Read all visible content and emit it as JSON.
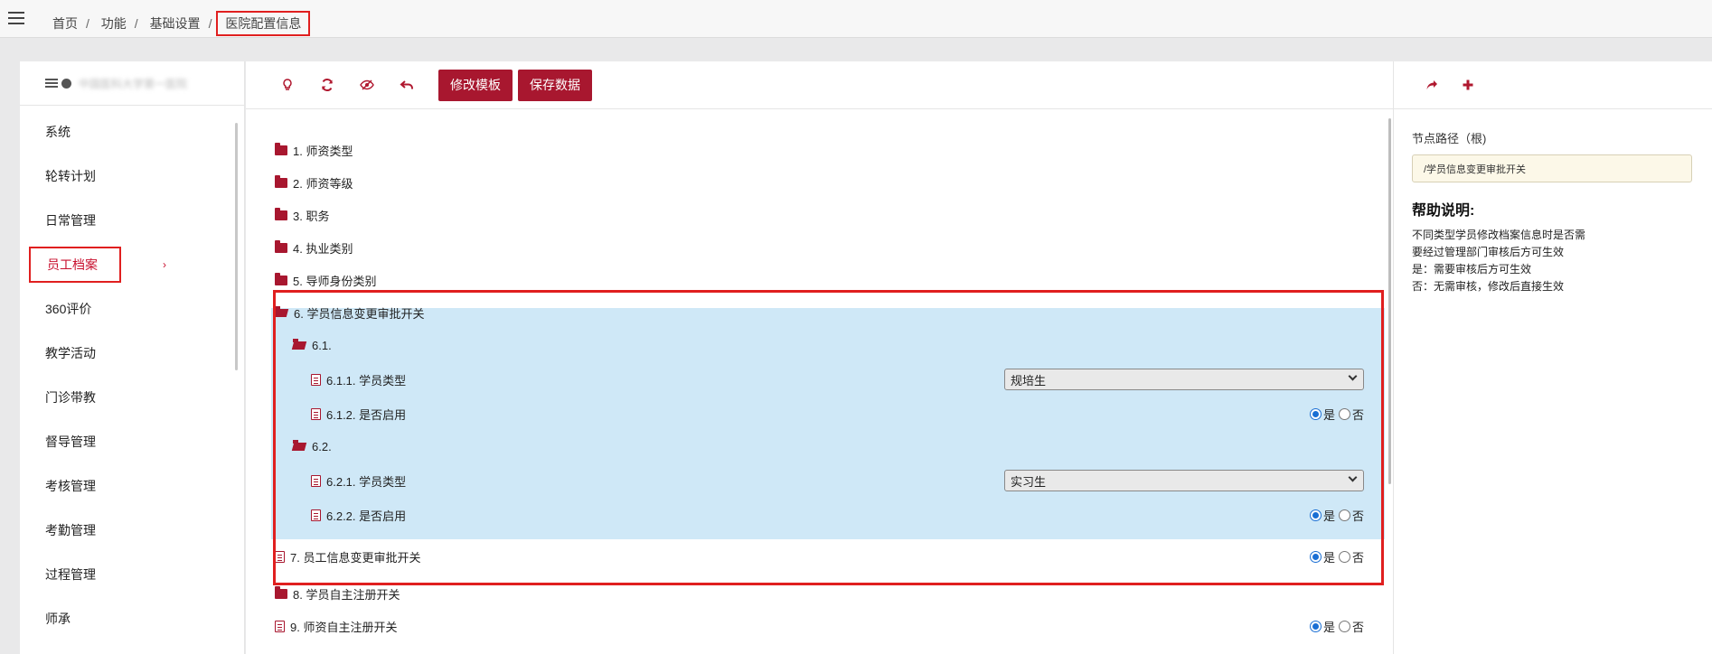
{
  "breadcrumb": {
    "items": [
      "首页",
      "功能",
      "基础设置"
    ],
    "current": "医院配置信息"
  },
  "sidebar": {
    "header_text": "中国医科大学第一医院",
    "items": [
      {
        "label": "系统"
      },
      {
        "label": "轮转计划"
      },
      {
        "label": "日常管理"
      },
      {
        "label": "员工档案",
        "active": true
      },
      {
        "label": "360评价"
      },
      {
        "label": "教学活动"
      },
      {
        "label": "门诊带教"
      },
      {
        "label": "督导管理"
      },
      {
        "label": "考核管理"
      },
      {
        "label": "考勤管理"
      },
      {
        "label": "过程管理"
      },
      {
        "label": "师承"
      }
    ]
  },
  "toolbar": {
    "icons": [
      "lightbulb-icon",
      "refresh-icon",
      "eye-slash-icon",
      "undo-icon"
    ],
    "edit_template_label": "修改模板",
    "save_data_label": "保存数据"
  },
  "tree": {
    "n1": "1. 师资类型",
    "n2": "2. 师资等级",
    "n3": "3. 职务",
    "n4": "4. 执业类别",
    "n5": "5. 导师身份类别",
    "n6": "6. 学员信息变更审批开关",
    "n6_1": "6.1.",
    "n6_1_1": "6.1.1. 学员类型",
    "n6_1_1_value": "规培生",
    "n6_1_2": "6.1.2. 是否启用",
    "n6_2": "6.2.",
    "n6_2_1": "6.2.1. 学员类型",
    "n6_2_1_value": "实习生",
    "n6_2_2": "6.2.2. 是否启用",
    "n7": "7. 员工信息变更审批开关",
    "n8": "8. 学员自主注册开关",
    "n9": "9. 师资自主注册开关",
    "yes": "是",
    "no": "否"
  },
  "right_panel": {
    "icons": [
      "share-icon",
      "plus-icon"
    ],
    "node_path_label": "节点路径（根)",
    "node_path_value": "/学员信息变更审批开关",
    "help_title": "帮助说明:",
    "help_lines": [
      "不同类型学员修改档案信息时是否需",
      "要经过管理部门审核后方可生效",
      "是：需要审核后方可生效",
      "否：无需审核，修改后直接生效"
    ]
  },
  "colors": {
    "accent": "#a8172f",
    "highlight": "#cfe8f7",
    "annotation": "#e01f1f"
  }
}
